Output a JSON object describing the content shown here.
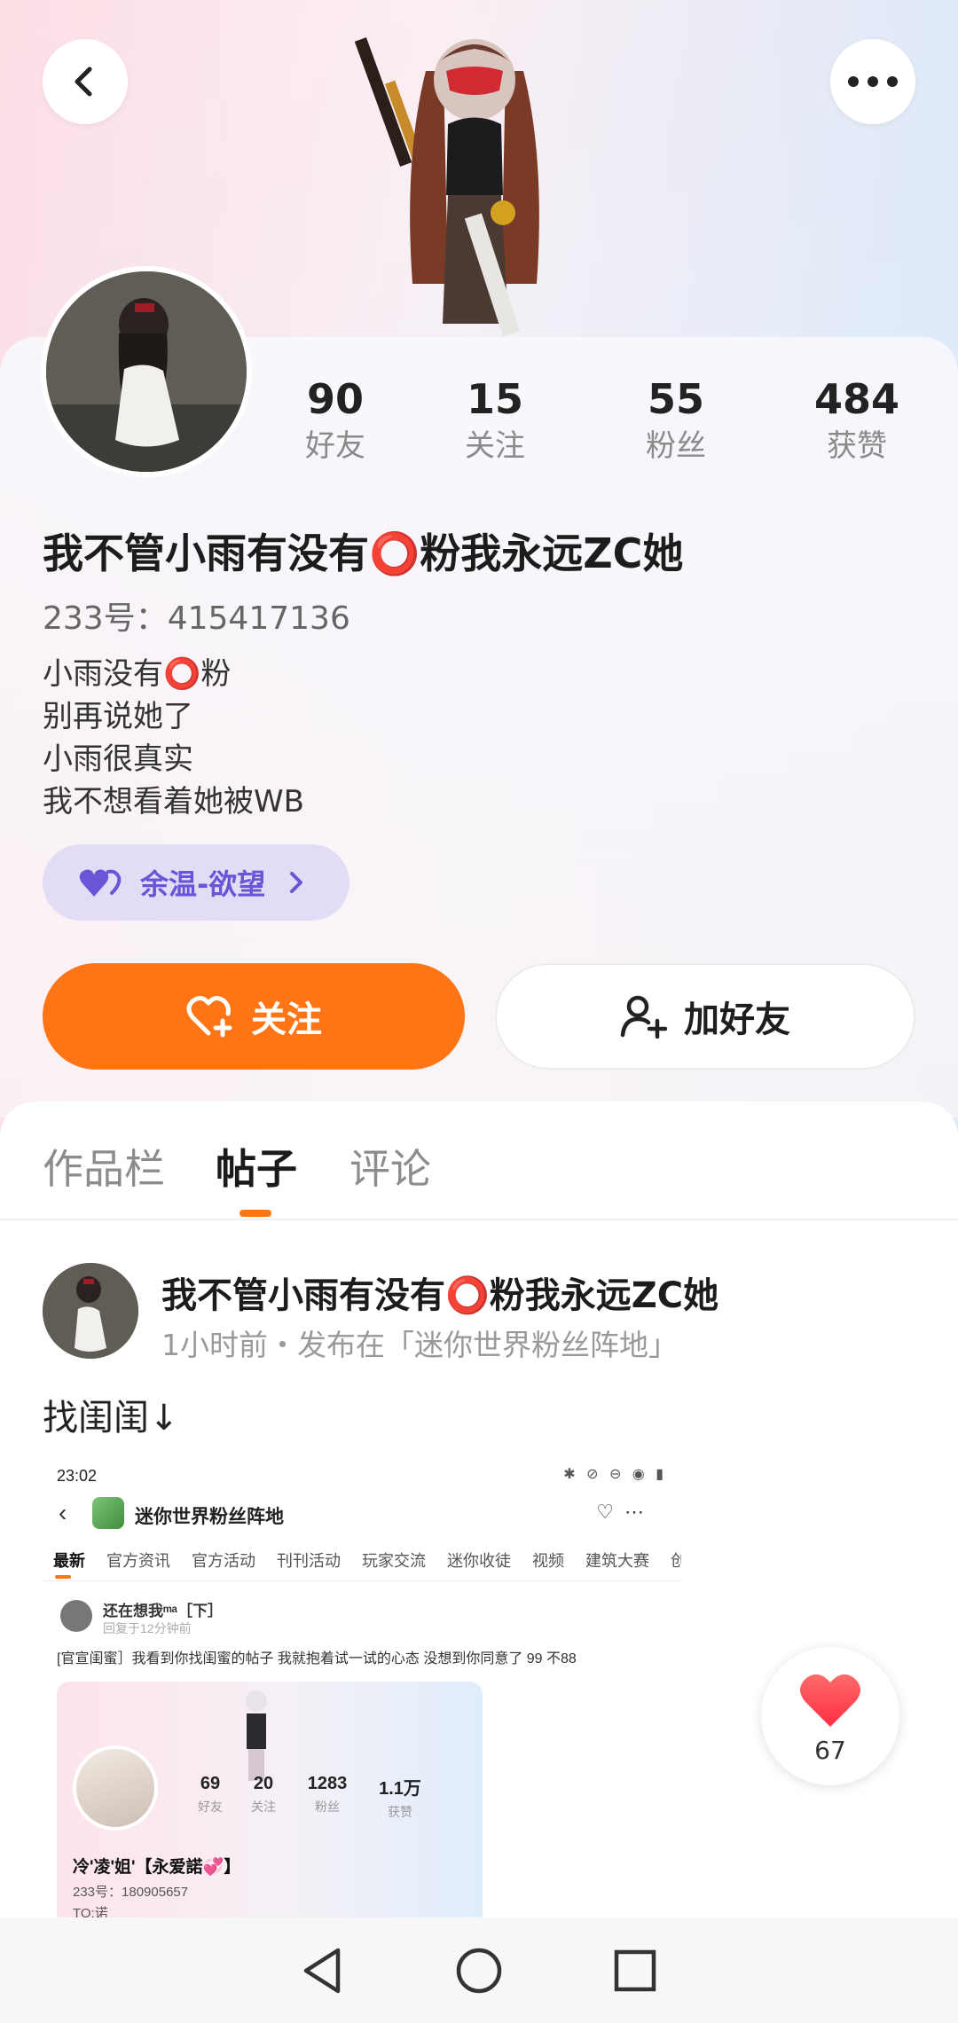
{
  "profile": {
    "username": "我不管小雨有没有⭕粉我永远ZC她",
    "uid_label": "233号：",
    "uid": "415417136",
    "bio": [
      "小雨没有⭕粉",
      "别再说她了",
      "小雨很真实",
      "我不想看着她被WB"
    ],
    "title_badge": "余温-欲望",
    "stats": [
      {
        "value": "90",
        "label": "好友"
      },
      {
        "value": "15",
        "label": "关注"
      },
      {
        "value": "55",
        "label": "粉丝"
      },
      {
        "value": "484",
        "label": "获赞"
      }
    ]
  },
  "actions": {
    "follow_label": "关注",
    "add_friend_label": "加好友"
  },
  "tabs": [
    {
      "label": "作品栏",
      "active": false
    },
    {
      "label": "帖子",
      "active": true
    },
    {
      "label": "评论",
      "active": false
    }
  ],
  "post": {
    "author": "我不管小雨有没有⭕粉我永远ZC她",
    "meta": "1小时前・发布在「迷你世界粉丝阵地」",
    "text": "找闺闺↓",
    "likes": "67",
    "screenshot": {
      "time": "23:02",
      "forum_name": "迷你世界粉丝阵地",
      "tabs": [
        "最新",
        "官方资讯",
        "官方活动",
        "刊刊活动",
        "玩家交流",
        "迷你收徒",
        "视频",
        "建筑大赛",
        "创作"
      ],
      "reply_name": "还在想我ᵐᵃ［下］",
      "reply_time": "回复于12分钟前",
      "reply_text": "[官宣闺蜜］我看到你找闺蜜的帖子 我就抱着试一试的心态 没想到你同意了 99 不88",
      "card": {
        "stats": [
          {
            "value": "69",
            "label": "好友"
          },
          {
            "value": "20",
            "label": "关注"
          },
          {
            "value": "1283",
            "label": "粉丝"
          },
          {
            "value": "1.1万",
            "label": "获赞"
          }
        ],
        "name": "冷'凌'姐'【永爱諾💞】",
        "uid": "233号：180905657",
        "to": "TO:诺"
      }
    }
  },
  "colors": {
    "accent": "#ff7414",
    "badge_text": "#6a55d6",
    "badge_bg": "#e3dcf5",
    "like": "#ff3b4a"
  },
  "icons": {
    "back": "chevron-left-icon",
    "more": "more-dots-icon",
    "follow": "heart-plus-icon",
    "add_friend": "user-plus-icon",
    "badge": "twin-hearts-icon",
    "like": "heart-icon",
    "nav": [
      "triangle-back-icon",
      "circle-home-icon",
      "square-recents-icon"
    ]
  }
}
